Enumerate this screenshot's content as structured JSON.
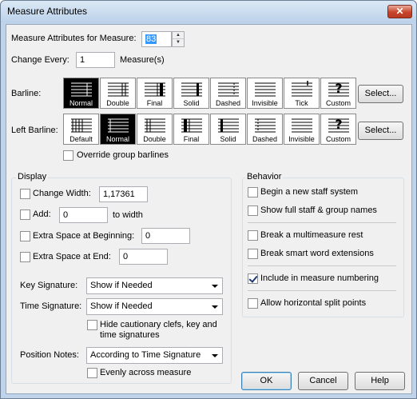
{
  "window": {
    "title": "Measure Attributes",
    "close_glyph": "✕"
  },
  "measure": {
    "label": "Measure Attributes for Measure:",
    "value": "83",
    "change_every_label": "Change Every:",
    "change_every_value": "1",
    "change_every_unit": "Measure(s)"
  },
  "barline": {
    "label": "Barline:",
    "select_label": "Select...",
    "selected": "Normal",
    "options": [
      "Normal",
      "Double",
      "Final",
      "Solid",
      "Dashed",
      "Invisible",
      "Tick",
      "Custom"
    ]
  },
  "left_barline": {
    "label": "Left Barline:",
    "select_label": "Select...",
    "selected": "Normal",
    "options": [
      "Default",
      "Normal",
      "Double",
      "Final",
      "Solid",
      "Dashed",
      "Invisible",
      "Custom"
    ]
  },
  "override_group": {
    "label": "Override group barlines",
    "checked": false
  },
  "display": {
    "title": "Display",
    "change_width": {
      "label": "Change Width:",
      "value": "1,17361",
      "checked": false
    },
    "add": {
      "label": "Add:",
      "value": "0",
      "suffix": "to width",
      "checked": false
    },
    "extra_begin": {
      "label": "Extra Space at Beginning:",
      "value": "0",
      "checked": false
    },
    "extra_end": {
      "label": "Extra Space at End:",
      "value": "0",
      "checked": false
    },
    "key_signature": {
      "label": "Key Signature:",
      "value": "Show if Needed"
    },
    "time_signature": {
      "label": "Time Signature:",
      "value": "Show if Needed"
    },
    "hide_cautionary": {
      "label_line1": "Hide cautionary clefs, key and",
      "label_line2": "time signatures",
      "checked": false
    },
    "position_notes": {
      "label": "Position Notes:",
      "value": "According to Time Signature"
    },
    "evenly": {
      "label": "Evenly across measure",
      "checked": false
    }
  },
  "behavior": {
    "title": "Behavior",
    "new_staff": {
      "label": "Begin a new staff system",
      "checked": false
    },
    "full_staff": {
      "label": "Show full staff & group names",
      "checked": false
    },
    "break_multi": {
      "label": "Break a multimeasure rest",
      "checked": false
    },
    "break_smart": {
      "label": "Break smart word extensions",
      "checked": false
    },
    "include_numbering": {
      "label": "Include in measure numbering",
      "checked": true
    },
    "split_points": {
      "label": "Allow horizontal split points",
      "checked": false
    }
  },
  "buttons": {
    "ok": "OK",
    "cancel": "Cancel",
    "help": "Help"
  }
}
